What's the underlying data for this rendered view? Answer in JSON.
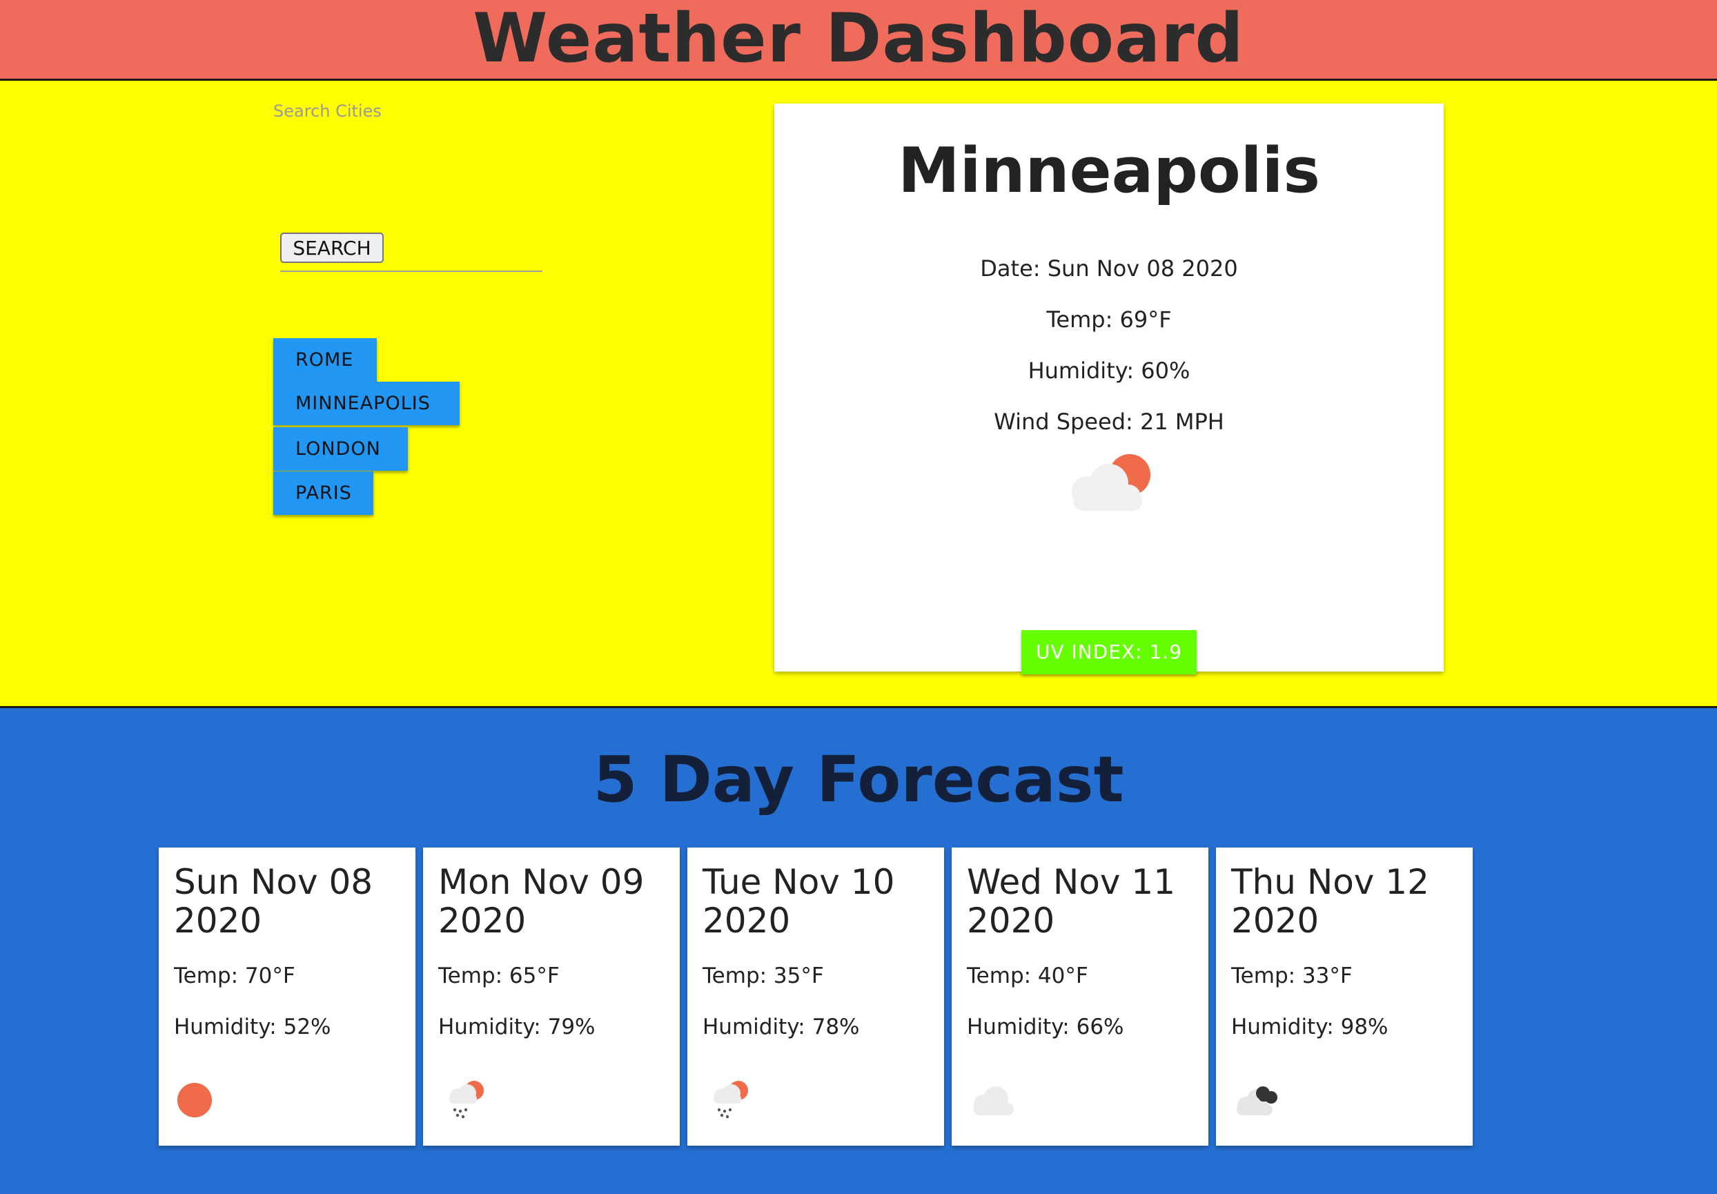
{
  "header": {
    "title": "Weather Dashboard",
    "background": "#ef6b5c"
  },
  "search": {
    "label": "Search Cities",
    "value": "",
    "button_label": "SEARCH"
  },
  "history": {
    "color": "#2196f3",
    "items": [
      "ROME",
      "MINNEAPOLIS",
      "LONDON",
      "PARIS"
    ]
  },
  "current": {
    "city": "Minneapolis",
    "date": "Date: Sun Nov 08 2020",
    "temp": "Temp: 69°F",
    "humidity": "Humidity: 60%",
    "wind": "Wind Speed: 21 MPH",
    "icon": "partly-cloudy-day-icon",
    "uv_label": "UV INDEX: 1.9",
    "uv_color": "#66ff00"
  },
  "forecast": {
    "title": "5 Day Forecast",
    "days": [
      {
        "date": "Sun Nov 08 2020",
        "temp": "Temp: 70°F",
        "humidity": "Humidity: 52%",
        "icon": "sun-icon"
      },
      {
        "date": "Mon Nov 09 2020",
        "temp": "Temp: 65°F",
        "humidity": "Humidity: 79%",
        "icon": "snow-sun-icon"
      },
      {
        "date": "Tue Nov 10 2020",
        "temp": "Temp: 35°F",
        "humidity": "Humidity: 78%",
        "icon": "snow-sun-icon"
      },
      {
        "date": "Wed Nov 11 2020",
        "temp": "Temp: 40°F",
        "humidity": "Humidity: 66%",
        "icon": "cloud-icon"
      },
      {
        "date": "Thu Nov 12 2020",
        "temp": "Temp: 33°F",
        "humidity": "Humidity: 98%",
        "icon": "broken-clouds-icon"
      }
    ]
  },
  "colors": {
    "top_section": "#ffff00",
    "bottom_section": "#256fd2",
    "sun": "#ef6b4a"
  }
}
